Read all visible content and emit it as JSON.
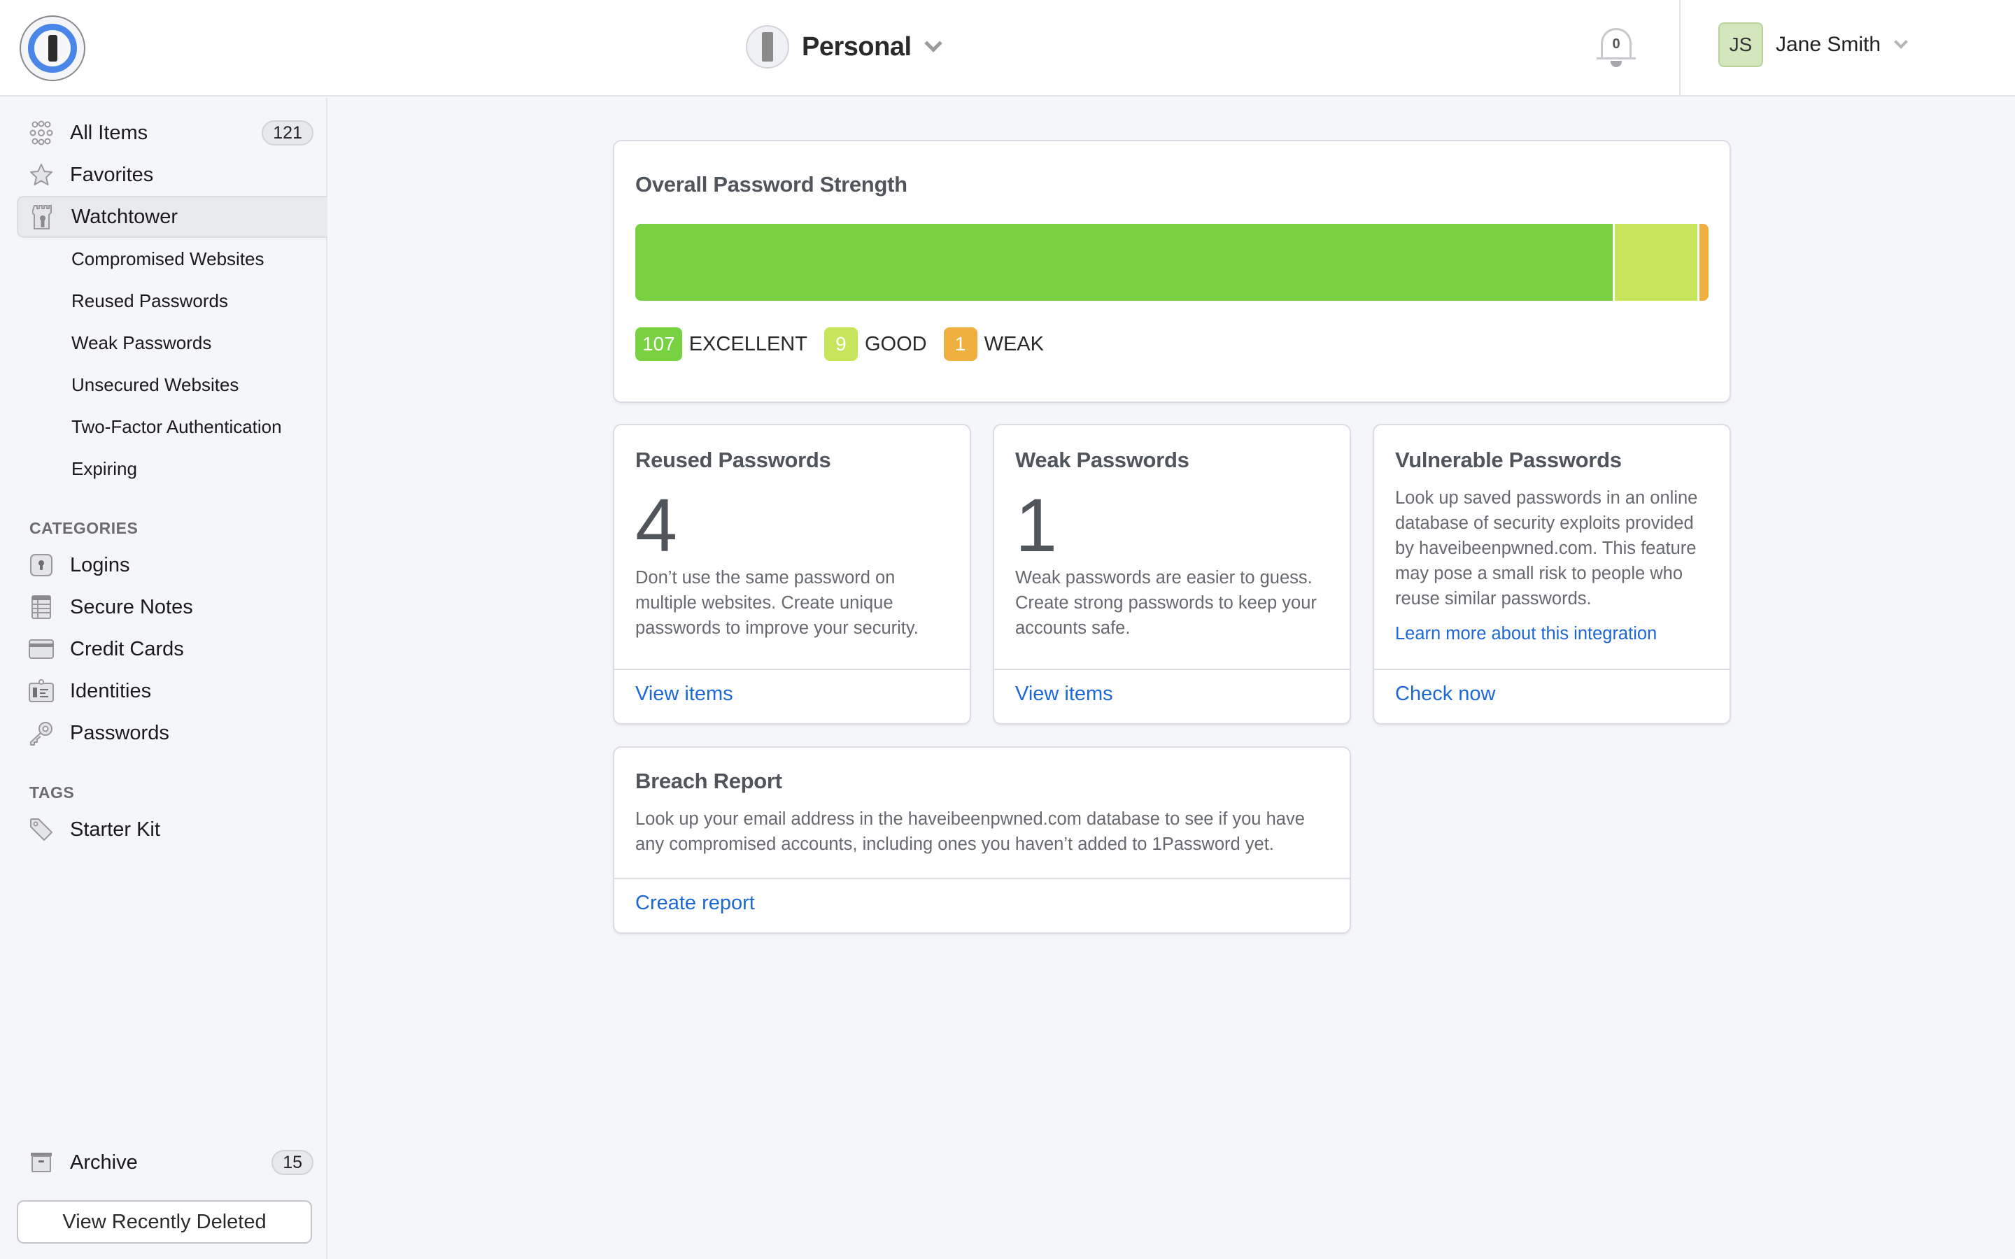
{
  "header": {
    "vault_name": "Personal",
    "notifications_count": "0",
    "user_initials": "JS",
    "user_name": "Jane Smith"
  },
  "sidebar": {
    "main_items": [
      {
        "label": "All Items",
        "icon": "grid-icon",
        "count": "121"
      },
      {
        "label": "Favorites",
        "icon": "star-icon"
      },
      {
        "label": "Watchtower",
        "icon": "watchtower-icon",
        "active": true
      }
    ],
    "watchtower_items": [
      {
        "label": "Compromised Websites"
      },
      {
        "label": "Reused Passwords"
      },
      {
        "label": "Weak Passwords"
      },
      {
        "label": "Unsecured Websites"
      },
      {
        "label": "Two-Factor Authentication"
      },
      {
        "label": "Expiring"
      }
    ],
    "categories_label": "CATEGORIES",
    "categories": [
      {
        "label": "Logins",
        "icon": "login-icon"
      },
      {
        "label": "Secure Notes",
        "icon": "note-icon"
      },
      {
        "label": "Credit Cards",
        "icon": "credit-card-icon"
      },
      {
        "label": "Identities",
        "icon": "identity-icon"
      },
      {
        "label": "Passwords",
        "icon": "key-icon"
      }
    ],
    "tags_label": "TAGS",
    "tags": [
      {
        "label": "Starter Kit",
        "icon": "tag-icon"
      }
    ],
    "archive": {
      "label": "Archive",
      "count": "15"
    },
    "recently_deleted_label": "View Recently Deleted"
  },
  "strength": {
    "title": "Overall Password Strength",
    "segments": [
      {
        "label": "EXCELLENT",
        "count": 107,
        "color": "#77d140"
      },
      {
        "label": "GOOD",
        "count": 9,
        "color": "#c6e55a"
      },
      {
        "label": "WEAK",
        "count": 1,
        "color": "#f0b040"
      }
    ]
  },
  "cards": {
    "reused": {
      "title": "Reused Passwords",
      "count": "4",
      "description": "Don’t use the same password on multiple websites. Create unique passwords to improve your security.",
      "action": "View items"
    },
    "weak": {
      "title": "Weak Passwords",
      "count": "1",
      "description": "Weak passwords are easier to guess. Create strong passwords to keep your accounts safe.",
      "action": "View items"
    },
    "vulnerable": {
      "title": "Vulnerable Passwords",
      "description": "Look up saved passwords in an online database of security exploits provided by haveibeenpwned.com. This feature may pose a small risk to people who reuse similar passwords.",
      "link": "Learn more about this integration",
      "action": "Check now"
    },
    "breach": {
      "title": "Breach Report",
      "description": "Look up your email address in the haveibeenpwned.com database to see if you have any compromised accounts, including ones you haven’t added to 1Password yet.",
      "action": "Create report"
    }
  },
  "colors": {
    "accent": "#1e68d6",
    "logo_blue": "#4a86e8"
  }
}
